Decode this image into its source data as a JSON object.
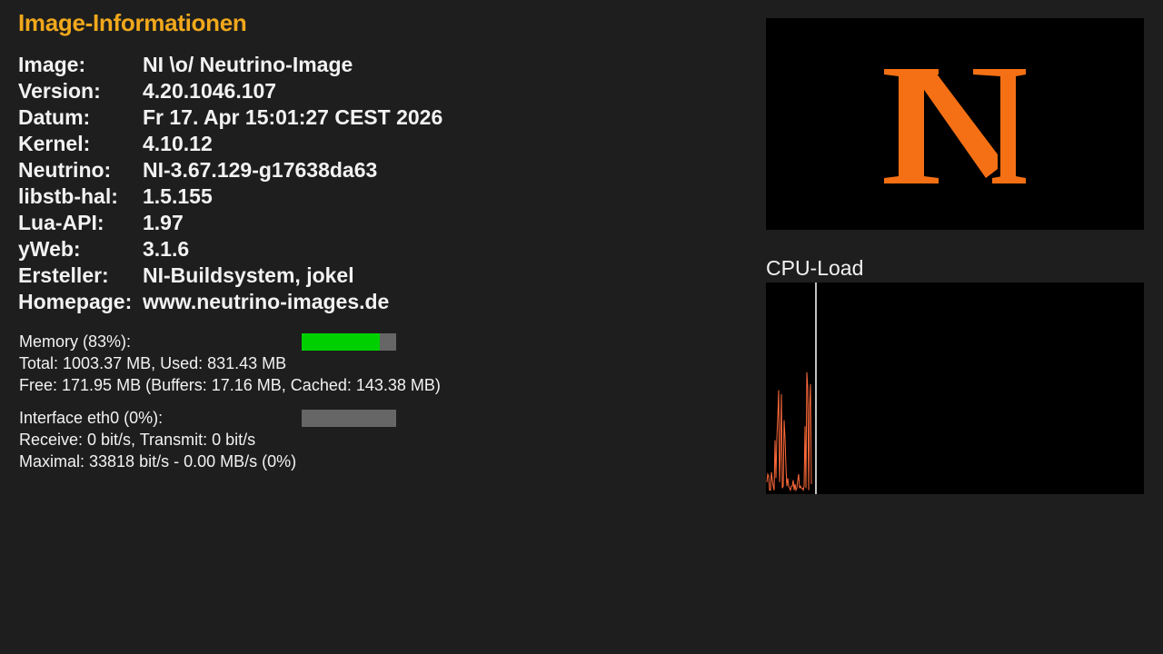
{
  "header": {
    "title": "Image-Informationen"
  },
  "info": [
    {
      "label": "Image:",
      "value": "NI \\o/ Neutrino-Image"
    },
    {
      "label": "Version:",
      "value": "4.20.1046.107"
    },
    {
      "label": "Datum:",
      "value": "Fr 17. Apr 15:01:27 CEST 2026"
    },
    {
      "label": "Kernel:",
      "value": "4.10.12"
    },
    {
      "label": "Neutrino:",
      "value": "NI-3.67.129-g17638da63"
    },
    {
      "label": "libstb-hal:",
      "value": "1.5.155"
    },
    {
      "label": "Lua-API:",
      "value": "1.97"
    },
    {
      "label": "yWeb:",
      "value": "3.1.6"
    },
    {
      "label": "Ersteller:",
      "value": "NI-Buildsystem, jokel"
    },
    {
      "label": "Homepage:",
      "value": "www.neutrino-images.de"
    }
  ],
  "memory": {
    "label": "Memory (83%):",
    "percent": 83,
    "total_line": "Total: 1003.37 MB, Used: 831.43 MB",
    "free_line": "Free: 171.95 MB (Buffers: 17.16 MB, Cached: 143.38 MB)"
  },
  "network": {
    "label": "Interface eth0 (0%):",
    "percent": 0,
    "receive_line": "Receive: 0 bit/s, Transmit: 0 bit/s",
    "max_line": "Maximal: 33818 bit/s - 0.00 MB/s (0%)"
  },
  "logo": {
    "text": "NI",
    "color": "#f57014"
  },
  "cpu": {
    "label": "CPU-Load",
    "line_color": "#ff6a3a",
    "cursor_color": "#ffffff",
    "samples": [
      6,
      10,
      9,
      2,
      2,
      11,
      7,
      4,
      2,
      27,
      8,
      28,
      38,
      52,
      6,
      23,
      50,
      3,
      4,
      37,
      28,
      14,
      4,
      8,
      4,
      3,
      2,
      4,
      4,
      7,
      2,
      5,
      2,
      3,
      7,
      10,
      3,
      4,
      3,
      3,
      2,
      4,
      34,
      3,
      61,
      53,
      2,
      43,
      55,
      5
    ]
  },
  "colors": {
    "background": "#1e1e1e",
    "title": "#f0a81c",
    "memory_bar": "#00d000",
    "bar_track": "#666666"
  }
}
